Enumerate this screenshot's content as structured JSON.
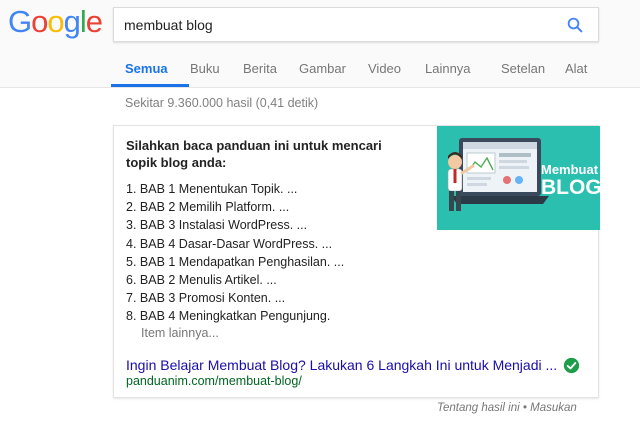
{
  "logo": {
    "letters": [
      "G",
      "o",
      "o",
      "g",
      "l",
      "e"
    ],
    "colors": [
      "#4285F4",
      "#EA4335",
      "#FBBC05",
      "#4285F4",
      "#34A853",
      "#EA4335"
    ]
  },
  "search": {
    "query": "membuat blog",
    "icon": "search-icon"
  },
  "tabs": [
    {
      "label": "Semua",
      "active": true
    },
    {
      "label": "Buku",
      "active": false
    },
    {
      "label": "Berita",
      "active": false
    },
    {
      "label": "Gambar",
      "active": false
    },
    {
      "label": "Video",
      "active": false
    },
    {
      "label": "Lainnya",
      "active": false
    },
    {
      "label": "Setelan",
      "active": false
    },
    {
      "label": "Alat",
      "active": false
    }
  ],
  "result_stats": "Sekitar 9.360.000 hasil (0,41 detik)",
  "featured_snippet": {
    "heading": "Silahkan baca panduan ini untuk mencari topik blog anda:",
    "steps": [
      "1. BAB 1 Menentukan Topik. ...",
      "2. BAB 2 Memilih Platform. ...",
      "3. BAB 3 Instalasi WordPress. ...",
      "4. BAB 4 Dasar-Dasar WordPress. ...",
      "5. BAB 1 Mendapatkan Penghasilan. ...",
      "6. BAB 2 Menulis Artikel. ...",
      "7. BAB 3 Promosi Konten. ...",
      "8. BAB 4 Meningkatkan Pengunjung."
    ],
    "more_items": "Item lainnya...",
    "image": {
      "line1": "Membuat",
      "line2": "BLOG",
      "bg_color": "#2bbfb0"
    },
    "result_title": "Ingin Belajar Membuat Blog? Lakukan 6 Langkah Ini untuk Menjadi ...",
    "result_url": "panduanim.com/membuat-blog/",
    "verified_icon": "check-circle-icon"
  },
  "footer": {
    "about": "Tentang hasil ini",
    "separator": "•",
    "feedback": "Masukan"
  },
  "colors": {
    "accent": "#1a73e8",
    "link": "#1a0dab",
    "url": "#006621",
    "verified": "#1e9e4a"
  }
}
